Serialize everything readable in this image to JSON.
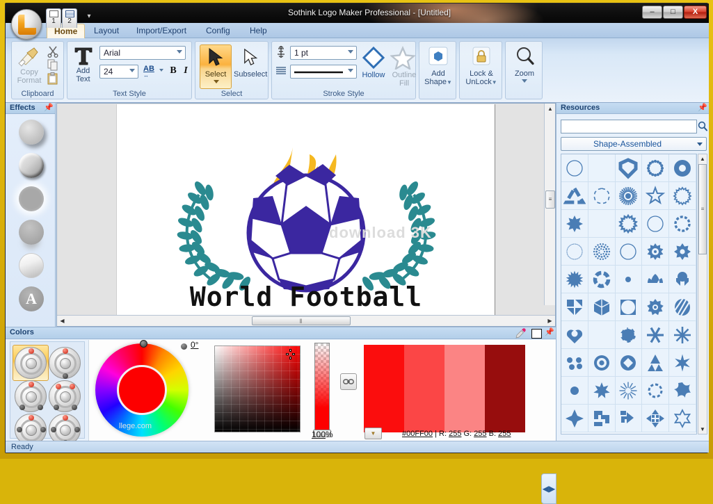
{
  "window": {
    "title": "Sothink Logo Maker Professional - [Untitled]",
    "minimize_label": "–",
    "maximize_label": "□",
    "close_label": "X"
  },
  "quick_access": {
    "item1_label": "1",
    "item2_label": "2",
    "dropdown_icon": "▾"
  },
  "ribbon": {
    "tabs": [
      {
        "label": "Home",
        "active": true
      },
      {
        "label": "Layout",
        "active": false
      },
      {
        "label": "Import/Export",
        "active": false
      },
      {
        "label": "Config",
        "active": false
      },
      {
        "label": "Help",
        "active": false
      }
    ],
    "groups": [
      {
        "name": "Clipboard",
        "label": "Clipboard",
        "copy_format_line1": "Copy",
        "copy_format_line2": "Format",
        "cut_tooltip": "Cut",
        "copy_tooltip": "Copy",
        "paste_tooltip": "Paste"
      },
      {
        "name": "Text Style",
        "label": "Text Style",
        "add_text_line1": "Add",
        "add_text_line2": "Text",
        "font_family": "Arial",
        "font_size": "24",
        "spacing_label": "AB",
        "bold_label": "B",
        "italic_label": "I"
      },
      {
        "name": "Select",
        "label": "Select",
        "select_label": "Select",
        "subselect_label": "Subselect"
      },
      {
        "name": "Stroke Style",
        "label": "Stroke Style",
        "stroke_width": "1 pt",
        "stroke_style": "——————",
        "hollow_label": "Hollow",
        "outline_fill_line1": "Outline",
        "outline_fill_line2": "Fill"
      },
      {
        "name": "Add Shape",
        "label": "",
        "add_shape_line1": "Add",
        "add_shape_line2": "Shape"
      },
      {
        "name": "Lock",
        "label": "",
        "lock_line1": "Lock &",
        "lock_line2": "UnLock"
      },
      {
        "name": "Zoom",
        "label": "",
        "zoom_label": "Zoom"
      }
    ]
  },
  "effects_panel": {
    "title": "Effects",
    "pin_icon": "pin-icon",
    "items": [
      {
        "name": "shadow-effect"
      },
      {
        "name": "bevel-effect"
      },
      {
        "name": "glow-effect"
      },
      {
        "name": "reflection-effect"
      },
      {
        "name": "gradient-effect"
      },
      {
        "name": "text-effect",
        "glyph": "A"
      }
    ]
  },
  "canvas": {
    "logo_text": "World  Football",
    "watermark": "download 3K",
    "flame_color": "#f5b820",
    "ball_color": "#3b27a0",
    "wreath_color": "#2a8a90",
    "text_color": "#111111",
    "hscroll_grip": "‖",
    "vscroll_grip": "≡",
    "arrow_left": "◀",
    "arrow_right": "▶",
    "arrow_up": "▲"
  },
  "colors_panel": {
    "title": "Colors",
    "pin_icon": "pin-icon",
    "eyedropper_icon": "eyedropper-icon",
    "angle_value": "0°",
    "alpha_value": "100",
    "alpha_unit": "%",
    "link_icon": "link-icon",
    "palette_dropdown_icon": "▼",
    "hex_value": "#00FF00",
    "separator": "|",
    "r_label": "R:",
    "r_value": "255",
    "g_label": "G:",
    "g_value": "255",
    "b_label": "B:",
    "b_value": "255",
    "current_color": "#fd0000",
    "palette_colors": [
      "#fb0d0d",
      "#fb4646",
      "#fb8484",
      "#970d0d"
    ],
    "scheme_buttons": [
      {
        "name": "mono-scheme",
        "selected": true
      },
      {
        "name": "complement-scheme",
        "selected": false
      },
      {
        "name": "analogous-scheme",
        "selected": false
      },
      {
        "name": "split-complement-scheme",
        "selected": false
      },
      {
        "name": "triad-scheme",
        "selected": false
      },
      {
        "name": "tetrad-scheme",
        "selected": false
      }
    ]
  },
  "resources_panel": {
    "title": "Resources",
    "pin_icon": "pin-icon",
    "search_value": "",
    "search_placeholder": "",
    "search_icon": "search-icon",
    "category": "Shape-Assembled",
    "collapse_icon": "◀▶",
    "scroll_up": "▲",
    "scroll_down": "▼",
    "scroll_grip": "≡",
    "shape_color": "#4a7db5",
    "shapes": [
      "trefoil-hex",
      "dashed-petal-ring",
      "shield-notch",
      "dotted-bead-ring",
      "thick-ring-flower",
      "triangle-loop",
      "dashed-hex-outline",
      "sunburst-dot",
      "star-outline",
      "scalloped-ring",
      "eight-point-star",
      "five-petal-flower",
      "scallop-ring-open",
      "thin-circle",
      "swirl-ring",
      "fine-dotted-circle",
      "halftone-dot-ring",
      "spiky-sun-ring",
      "gear-ring",
      "gear-solid",
      "starburst-solid",
      "broken-ring",
      "cherry-blossom",
      "lotus-leaf",
      "three-pod-shield",
      "pinwheel-squares",
      "cube-3d",
      "square-circle-cut",
      "flower-gear",
      "striped-oval",
      "heart-trefoil",
      "hex-flower-ring",
      "broken-pentagon",
      "six-ray-asterisk",
      "eight-ray-asterisk",
      "four-dot-cluster",
      "target-circle",
      "diamond-in-circle",
      "tri-fan",
      "bold-asterisk",
      "six-petal-blob",
      "seven-point-star",
      "thin-ray-burst",
      "dashed-ray-circle",
      "spiral-star",
      "four-point-diamond",
      "pinwheel-arrows",
      "arrow-bend",
      "four-arrow-cross",
      "six-point-outline-star"
    ]
  },
  "status_bar": {
    "text": "Ready"
  }
}
